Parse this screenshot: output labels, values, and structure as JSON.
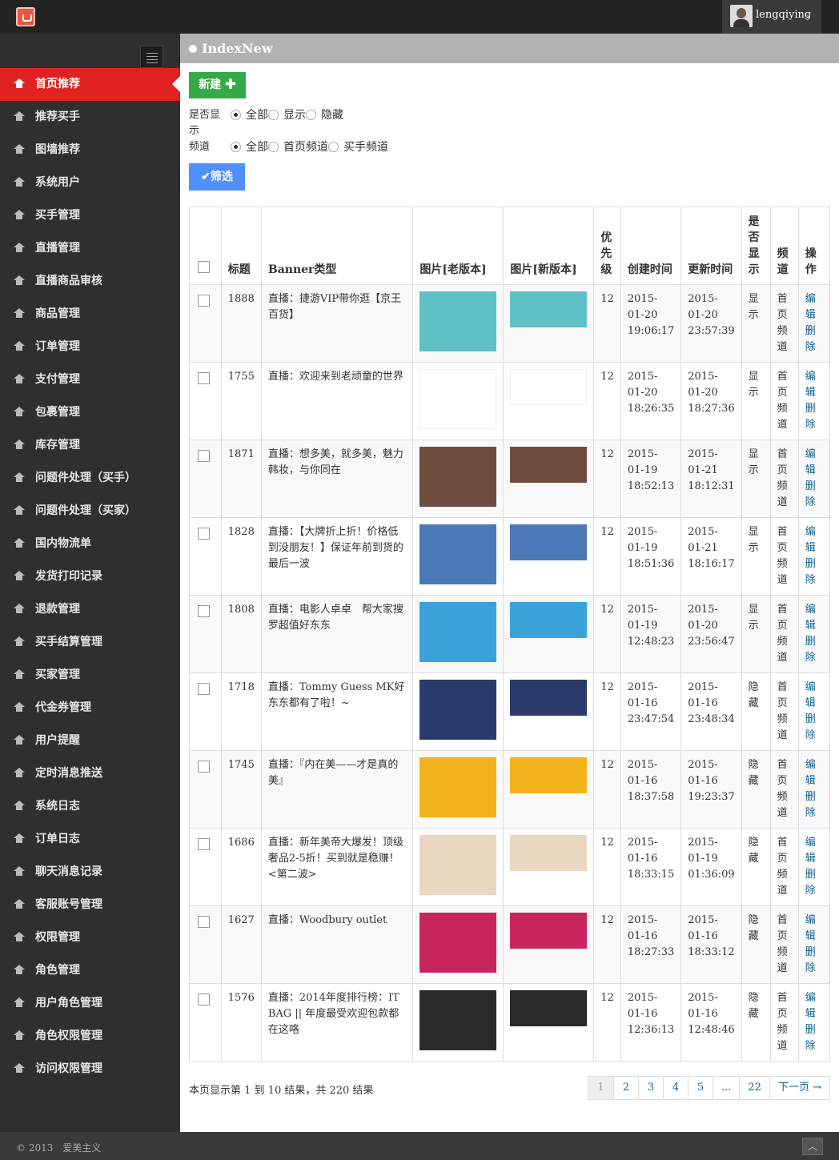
{
  "topbar": {
    "username": "lengqiying",
    "logo_icon": "shopping-bag-icon"
  },
  "sidebar": {
    "items": [
      "首页推荐",
      "推荐买手",
      "图墙推荐",
      "系统用户",
      "买手管理",
      "直播管理",
      "直播商品审核",
      "商品管理",
      "订单管理",
      "支付管理",
      "包裹管理",
      "库存管理",
      "问题件处理（买手）",
      "问题件处理（买家）",
      "国内物流单",
      "发货打印记录",
      "退款管理",
      "买手结算管理",
      "买家管理",
      "代金券管理",
      "用户提醒",
      "定时消息推送",
      "系统日志",
      "订单日志",
      "聊天消息记录",
      "客服账号管理",
      "权限管理",
      "角色管理",
      "用户角色管理",
      "角色权限管理",
      "访问权限管理"
    ],
    "active_index": 0
  },
  "content": {
    "title": "IndexNew",
    "new_button": "新建",
    "filter_button": "筛选",
    "filters": {
      "show_label": "是否显示",
      "show_options": [
        "全部",
        "显示",
        "隐藏"
      ],
      "channel_label": "频道",
      "channel_options": [
        "全部",
        "首页频道",
        "买手频道"
      ]
    }
  },
  "table": {
    "headers": [
      "",
      "标题",
      "Banner类型",
      "图片[老版本]",
      "图片[新版本]",
      "优先级",
      "创建时间",
      "更新时间",
      "是否显示",
      "频道",
      "操作"
    ],
    "rows": [
      {
        "id": "1888",
        "title": "直播：捷游VIP带你逛【京王百货】",
        "priority": "12",
        "created": "2015-01-20 19:06:17",
        "updated": "2015-01-20 23:57:39",
        "show": "显示",
        "channel": "首页频道",
        "img_color": "#5fc1c6"
      },
      {
        "id": "1755",
        "title": "直播：欢迎来到老顽童的世界",
        "priority": "12",
        "created": "2015-01-20 18:26:35",
        "updated": "2015-01-20 18:27:36",
        "show": "显示",
        "channel": "首页频道",
        "img_color": "#ffffff"
      },
      {
        "id": "1871",
        "title": "直播：想多美，就多美，魅力韩妆，与你同在",
        "priority": "12",
        "created": "2015-01-19 18:52:13",
        "updated": "2015-01-21 18:12:31",
        "show": "显示",
        "channel": "首页频道",
        "img_color": "#6e4d3e"
      },
      {
        "id": "1828",
        "title": "直播：【大牌折上折！价格低到没朋友！】保证年前到货的最后一波",
        "priority": "12",
        "created": "2015-01-19 18:51:36",
        "updated": "2015-01-21 18:16:17",
        "show": "显示",
        "channel": "首页频道",
        "img_color": "#4b79b8"
      },
      {
        "id": "1808",
        "title": "直播：电影人卓卓　帮大家搜罗超值好东东",
        "priority": "12",
        "created": "2015-01-19 12:48:23",
        "updated": "2015-01-20 23:56:47",
        "show": "显示",
        "channel": "首页频道",
        "img_color": "#3aa3d9"
      },
      {
        "id": "1718",
        "title": "直播：Tommy Guess MK好东东都有了啦！~",
        "priority": "12",
        "created": "2015-01-16 23:47:54",
        "updated": "2015-01-16 23:48:34",
        "show": "隐藏",
        "channel": "首页频道",
        "img_color": "#2a3a6a"
      },
      {
        "id": "1745",
        "title": "直播：『内在美——才是真的美』",
        "priority": "12",
        "created": "2015-01-16 18:37:58",
        "updated": "2015-01-16 19:23:37",
        "show": "隐藏",
        "channel": "首页频道",
        "img_color": "#f2b21c"
      },
      {
        "id": "1686",
        "title": "直播：新年美帝大爆发！顶级奢品2-5折！买到就是稳赚！<第二波>",
        "priority": "12",
        "created": "2015-01-16 18:33:15",
        "updated": "2015-01-19 01:36:09",
        "show": "隐藏",
        "channel": "首页频道",
        "img_color": "#e9d7c2"
      },
      {
        "id": "1627",
        "title": "直播：Woodbury outlet",
        "priority": "12",
        "created": "2015-01-16 18:27:33",
        "updated": "2015-01-16 18:33:12",
        "show": "隐藏",
        "channel": "首页频道",
        "img_color": "#c8245e"
      },
      {
        "id": "1576",
        "title": "直播：2014年度排行榜：IT BAG || 年度最受欢迎包款都在这咯",
        "priority": "12",
        "created": "2015-01-16 12:36:13",
        "updated": "2015-01-16 12:48:46",
        "show": "隐藏",
        "channel": "首页频道",
        "img_color": "#2a2a2a"
      }
    ],
    "edit_label": "编辑",
    "delete_label": "删除"
  },
  "pagination": {
    "summary": "本页显示第 1 到 10 结果，共 220 结果",
    "pages": [
      "1",
      "2",
      "3",
      "4",
      "5",
      "...",
      "22"
    ],
    "next": "下一页 →",
    "current": "1"
  },
  "footer": {
    "copyright": "© 2013　爱美主义",
    "scroll_icon": "chevron-up-icon"
  }
}
